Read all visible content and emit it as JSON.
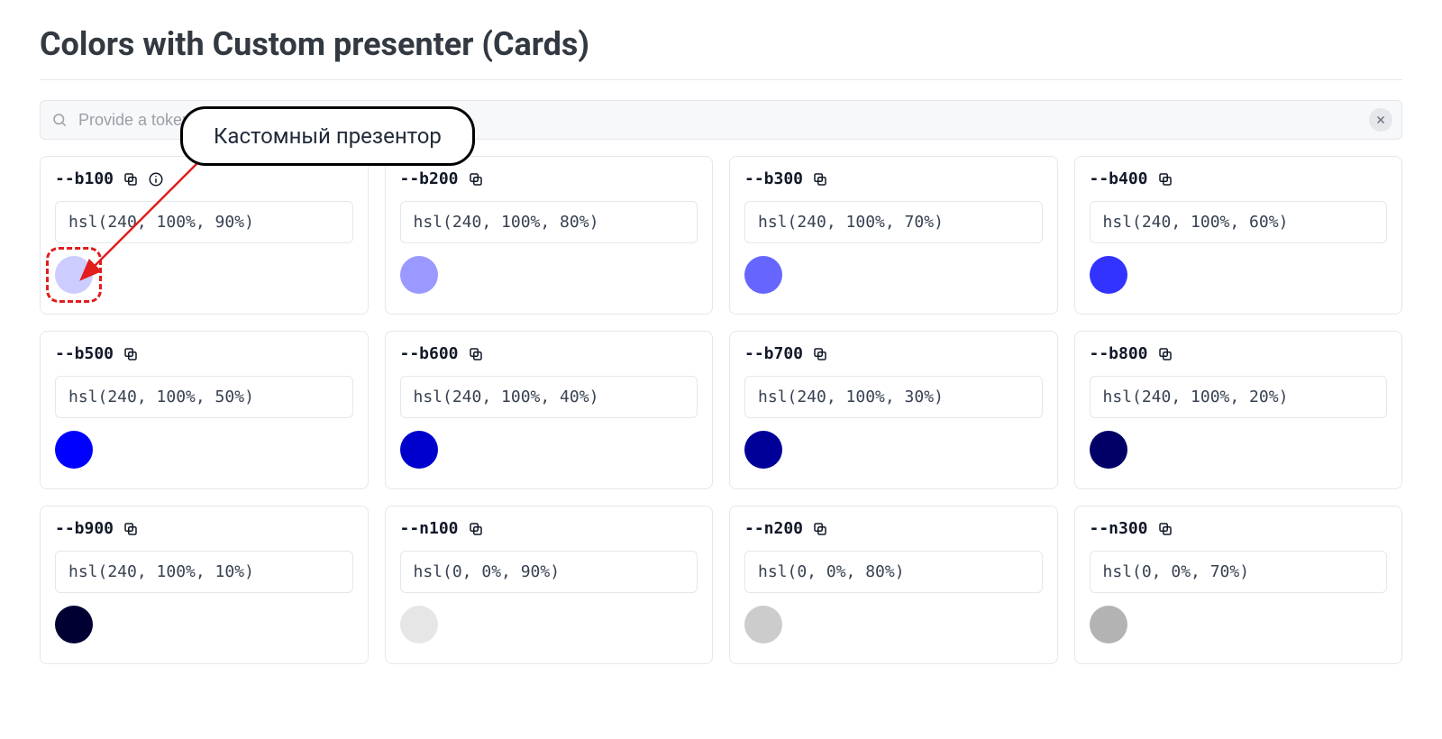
{
  "title": "Colors with Custom presenter (Cards)",
  "search": {
    "placeholder": "Provide a token name to filter..."
  },
  "callout": {
    "text": "Кастомный презентор"
  },
  "tokens": [
    {
      "name": "--b100",
      "value": "hsl(240, 100%, 90%)",
      "color": "hsl(240,100%,90%)",
      "info": true,
      "highlight": true
    },
    {
      "name": "--b200",
      "value": "hsl(240, 100%, 80%)",
      "color": "hsl(240,100%,80%)",
      "info": false,
      "highlight": false
    },
    {
      "name": "--b300",
      "value": "hsl(240, 100%, 70%)",
      "color": "hsl(240,100%,70%)",
      "info": false,
      "highlight": false
    },
    {
      "name": "--b400",
      "value": "hsl(240, 100%, 60%)",
      "color": "hsl(240,100%,60%)",
      "info": false,
      "highlight": false
    },
    {
      "name": "--b500",
      "value": "hsl(240, 100%, 50%)",
      "color": "hsl(240,100%,50%)",
      "info": false,
      "highlight": false
    },
    {
      "name": "--b600",
      "value": "hsl(240, 100%, 40%)",
      "color": "hsl(240,100%,40%)",
      "info": false,
      "highlight": false
    },
    {
      "name": "--b700",
      "value": "hsl(240, 100%, 30%)",
      "color": "hsl(240,100%,30%)",
      "info": false,
      "highlight": false
    },
    {
      "name": "--b800",
      "value": "hsl(240, 100%, 20%)",
      "color": "hsl(240,100%,20%)",
      "info": false,
      "highlight": false
    },
    {
      "name": "--b900",
      "value": "hsl(240, 100%, 10%)",
      "color": "hsl(240,100%,10%)",
      "info": false,
      "highlight": false
    },
    {
      "name": "--n100",
      "value": "hsl(0, 0%, 90%)",
      "color": "hsl(0,0%,90%)",
      "info": false,
      "highlight": false
    },
    {
      "name": "--n200",
      "value": "hsl(0, 0%, 80%)",
      "color": "hsl(0,0%,80%)",
      "info": false,
      "highlight": false
    },
    {
      "name": "--n300",
      "value": "hsl(0, 0%, 70%)",
      "color": "hsl(0,0%,70%)",
      "info": false,
      "highlight": false
    }
  ]
}
